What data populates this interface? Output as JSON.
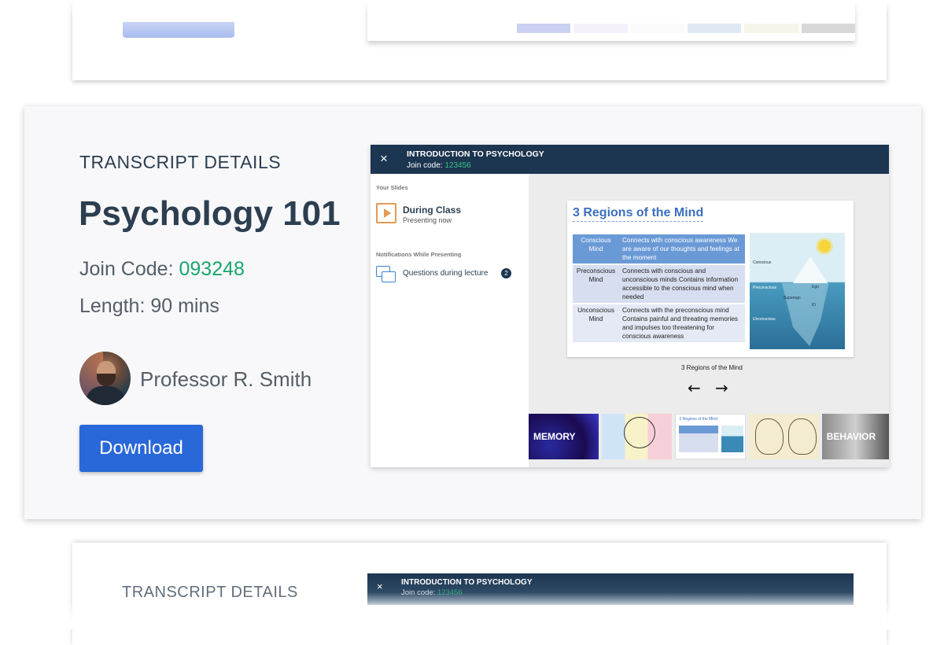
{
  "transcript": {
    "section_label": "TRANSCRIPT DETAILS",
    "course_title": "Psychology 101",
    "join_code_label": "Join Code:",
    "join_code": "093248",
    "length": "Length: 90 mins",
    "professor": "Professor R. Smith",
    "download_label": "Download"
  },
  "presenter": {
    "title": "INTRODUCTION TO PSYCHOLOGY",
    "join_label": "Join code:",
    "join_code": "123456",
    "close_icon": "×",
    "sidebar": {
      "slides_heading": "Your Slides",
      "current_slide_title": "During Class",
      "current_slide_status": "Presenting now",
      "notifications_heading": "Notifications While Presenting",
      "notification_label": "Questions during lecture",
      "notification_count": "2"
    },
    "slide": {
      "title": "3 Regions of the Mind",
      "rows": [
        {
          "region": "Conscious Mind",
          "desc": "Connects with conscious awareness We are aware of our thoughts and feelings at the moment"
        },
        {
          "region": "Preconscious Mind",
          "desc": "Connects with conscious and unconscious minds Contains information accessible to the conscious mind when needed"
        },
        {
          "region": "Unconscious Mind",
          "desc": "Connects with the preconscious mind Contains painful and threating memories and impulses too threatening for conscious awareness"
        }
      ],
      "iceberg_labels": [
        "Conscious",
        "Preconscious",
        "Ego",
        "Superego",
        "ID",
        "Unconscious"
      ],
      "caption": "3 Regions of the Mind"
    },
    "nav": {
      "prev": "←",
      "next": "→"
    },
    "thumbnails": [
      {
        "label": "MEMORY"
      },
      {
        "label": ""
      },
      {
        "label": "3 Regions of the Mind"
      },
      {
        "label": ""
      },
      {
        "label": "BEHAVIOR"
      }
    ]
  },
  "bottom_card": {
    "section_label": "TRANSCRIPT DETAILS",
    "title": "INTRODUCTION TO PSYCHOLOGY",
    "join_label": "Join code:",
    "join_code": "123456"
  },
  "icons": {
    "slide": "play-slide-icon",
    "notification": "chat-bubbles-icon",
    "close": "close-icon"
  },
  "colors": {
    "accent_blue": "#2868d8",
    "code_green": "#1aa56d",
    "header_navy": "#1c3550",
    "slide_blue": "#3b6fc0"
  }
}
